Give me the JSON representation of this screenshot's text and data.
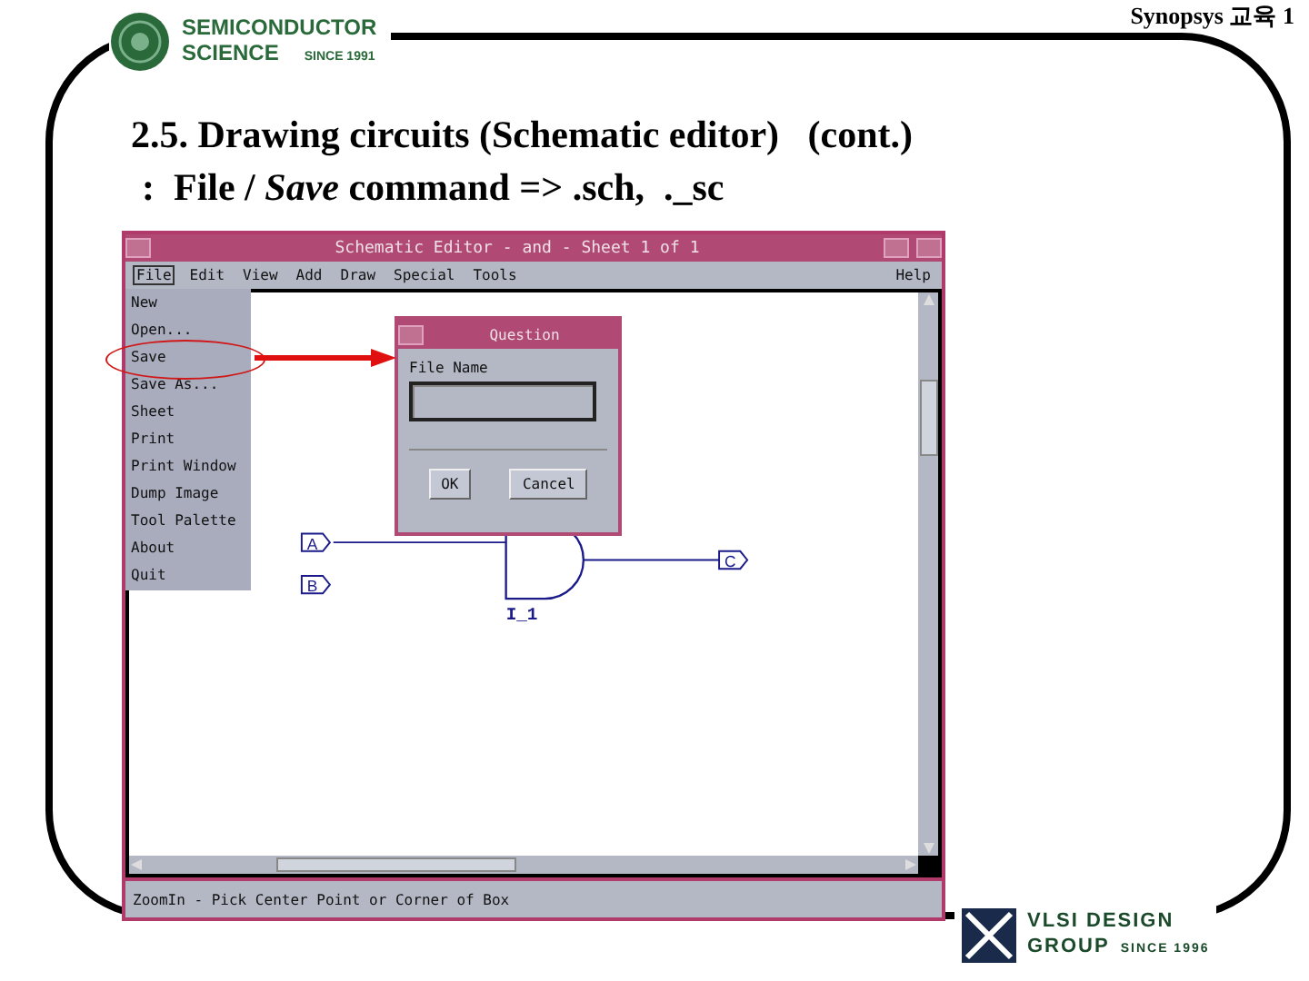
{
  "header": {
    "logo_lines": [
      "SEMICONDUCTOR",
      "SCIENCE"
    ],
    "logo_since": "SINCE 1991",
    "course": "Synopsys 교육 1"
  },
  "slide_title": [
    "2.5. Drawing circuits (Schematic editor)   (cont.)",
    ":  File / *Save* command => .sch,  ._sc"
  ],
  "window": {
    "title": "Schematic Editor - and - Sheet 1 of 1",
    "menus": [
      {
        "label": "File",
        "selected": true
      },
      {
        "label": "Edit",
        "selected": false
      },
      {
        "label": "View",
        "selected": false
      },
      {
        "label": "Add",
        "selected": false
      },
      {
        "label": "Draw",
        "selected": false
      },
      {
        "label": "Special",
        "selected": false
      },
      {
        "label": "Tools",
        "selected": false
      }
    ],
    "help": "Help",
    "file_menu": [
      {
        "label": "New",
        "circled": false
      },
      {
        "label": "Open...",
        "circled": false
      },
      {
        "label": "Save",
        "circled": true
      },
      {
        "label": "Save As...",
        "circled": false
      },
      {
        "label": "Sheet",
        "circled": false
      },
      {
        "label": "Print",
        "circled": false
      },
      {
        "label": "Print Window",
        "circled": false
      },
      {
        "label": "Dump Image",
        "circled": false
      },
      {
        "label": "Tool Palette",
        "circled": false
      },
      {
        "label": "About",
        "circled": false
      },
      {
        "label": "Quit",
        "circled": false
      }
    ],
    "dialog": {
      "title": "Question",
      "field_label": "File Name",
      "buttons": [
        "OK",
        "Cancel"
      ]
    },
    "schematic": {
      "inputs": [
        "A",
        "B"
      ],
      "output": "C",
      "instance": "I_1"
    },
    "status": "ZoomIn - Pick Center Point or Corner of Box"
  },
  "footer": {
    "logo_lines": [
      "VLSI DESIGN",
      "GROUP"
    ],
    "since": "SINCE 1996"
  }
}
